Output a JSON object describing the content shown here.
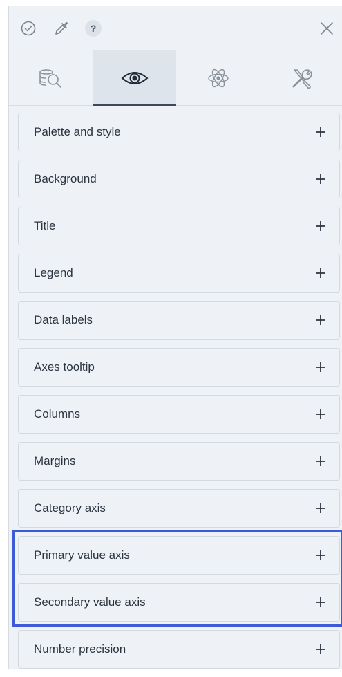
{
  "toolbar": {
    "icons": [
      "check-circle-icon",
      "eyedropper-icon",
      "help-icon",
      "close-icon"
    ],
    "help_label": "?"
  },
  "tabs": [
    {
      "icon": "data-search-icon",
      "active": false
    },
    {
      "icon": "eye-icon",
      "active": true
    },
    {
      "icon": "atom-icon",
      "active": false
    },
    {
      "icon": "tools-icon",
      "active": false
    }
  ],
  "sections": [
    {
      "label": "Palette and style"
    },
    {
      "label": "Background"
    },
    {
      "label": "Title"
    },
    {
      "label": "Legend"
    },
    {
      "label": "Data labels"
    },
    {
      "label": "Axes tooltip"
    },
    {
      "label": "Columns"
    },
    {
      "label": "Margins"
    },
    {
      "label": "Category axis"
    },
    {
      "label": "Primary value axis"
    },
    {
      "label": "Secondary value axis"
    },
    {
      "label": "Number precision"
    }
  ],
  "colors": {
    "panel_bg": "#eef1f5",
    "active_tab_bg": "#dde4ec",
    "highlight": "#3d5bd9",
    "text": "#2b3440"
  }
}
